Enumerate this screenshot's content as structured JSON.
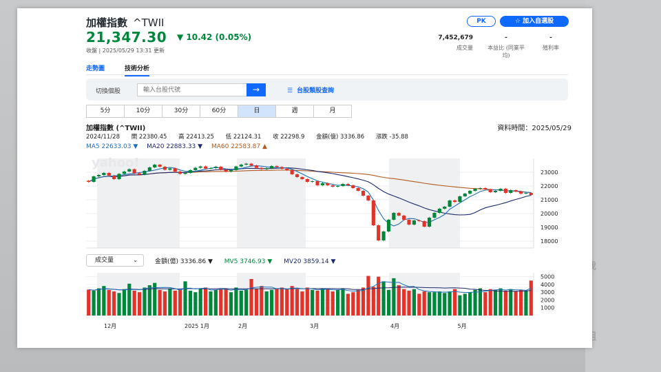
{
  "header": {
    "name": "加權指數",
    "symbol": "^TWII",
    "price": "21,347.30",
    "change": "▼ 10.42 (0.05%)",
    "closed_note": "收盤 | 2025/05/29 13:31 更新",
    "pk_label": "PK",
    "watch_label": "☆  加入自選股"
  },
  "stats": [
    {
      "value": "7,452,679",
      "label": "成交量"
    },
    {
      "value": "-",
      "label": "本益比 (同業平均)"
    },
    {
      "value": "-",
      "label": "殖利率"
    }
  ],
  "tabs": [
    {
      "label": "走勢圖",
      "active": false
    },
    {
      "label": "技術分析",
      "active": true
    }
  ],
  "switcher": {
    "label": "切換個股",
    "placeholder": "輸入台股代號",
    "go_icon": "→",
    "category_icon": "☰",
    "category_label": "台股類股查詢"
  },
  "intervals": [
    "5分",
    "10分",
    "30分",
    "60分",
    "日",
    "週",
    "月"
  ],
  "selected_interval": "日",
  "chart_header": {
    "title": "加權指數 (^TWII)",
    "data_time": "資料時間：2025/05/29",
    "date": "2024/11/28",
    "open": "開 22380.45",
    "high": "高 22413.25",
    "low": "低 22124.31",
    "close": "收 22298.9",
    "amount": "金額(億) 3336.86",
    "change": "漲跌 -35.88"
  },
  "ma": [
    {
      "label": "MA5 22633.03 ▼",
      "color": "#1f6fb5"
    },
    {
      "label": "MA20 22883.33 ▼",
      "color": "#1e2a6b"
    },
    {
      "label": "MA60 22583.87 ▲",
      "color": "#b35a1f"
    }
  ],
  "volume_header": {
    "select_label": "成交量",
    "amount": "金額(億) 3336.86 ▼",
    "mv5": "MV5 3746.93 ▼",
    "mv20": "MV20 3859.14 ▼"
  },
  "x_axis": [
    "12月",
    "2025 1月",
    "2月",
    "3月",
    "4月",
    "5月"
  ],
  "watermark": "yahoo!",
  "colors": {
    "up": "#00873c",
    "down": "#e0342b",
    "accent": "#0f69ff",
    "ma5": "#1f6fb5",
    "ma20": "#1e2a6b",
    "ma60": "#b35a1f"
  },
  "chart_data": [
    {
      "type": "candlestick",
      "title": "加權指數 (^TWII)",
      "ylim": [
        17000,
        24000
      ],
      "y_ticks": [
        18000,
        19000,
        20000,
        21000,
        22000,
        23000
      ],
      "x_labels": [
        "12月",
        "2025 1月",
        "2月",
        "3月",
        "4月",
        "5月"
      ],
      "close": [
        22298.9,
        22700,
        22800,
        22950,
        22750,
        22500,
        22880,
        23050,
        23220,
        22920,
        22830,
        23100,
        23350,
        23550,
        23400,
        23180,
        23280,
        23050,
        22880,
        22950,
        23150,
        23320,
        23420,
        23270,
        23300,
        23400,
        23180,
        23050,
        23150,
        23420,
        23550,
        23620,
        23480,
        23320,
        23220,
        23300,
        23450,
        23380,
        23250,
        23150,
        22850,
        22650,
        22500,
        22300,
        22350,
        22050,
        22200,
        22050,
        21950,
        22000,
        22150,
        22050,
        21850,
        21650,
        21300,
        20950,
        19150,
        18050,
        18700,
        19550,
        20050,
        19850,
        19550,
        19200,
        19500,
        19450,
        19050,
        19700,
        20050,
        20350,
        20500,
        20950,
        20850,
        21250,
        21450,
        21650,
        21800,
        21850,
        21750,
        21550,
        21650,
        21800,
        21500,
        21700,
        21600,
        21450,
        21500,
        21347.3
      ]
    },
    {
      "type": "bar",
      "title": "成交量",
      "ylim": [
        0,
        5500
      ],
      "y_ticks": [
        1000,
        2000,
        3000,
        4000,
        5000
      ],
      "values": [
        3336,
        3200,
        3500,
        3800,
        3300,
        3100,
        2900,
        3400,
        4100,
        3200,
        3000,
        3600,
        3900,
        4200,
        3300,
        3100,
        3500,
        3200,
        3300,
        4400,
        3200,
        3000,
        3500,
        3600,
        3100,
        3300,
        3400,
        3500,
        3000,
        3600,
        3200,
        3300,
        4700,
        3400,
        3800,
        3100,
        3300,
        3500,
        3600,
        3400,
        3800,
        3400,
        3100,
        3600,
        3300,
        3200,
        3500,
        3400,
        3100,
        3300,
        3500,
        2800,
        3000,
        3300,
        3600,
        5100,
        3700,
        5000,
        4400,
        3300,
        4800,
        3900,
        3400,
        3200,
        3400,
        2800,
        3100,
        3000,
        3000,
        3100,
        2900,
        3100,
        3400,
        2600,
        2800,
        3000,
        3300,
        3500,
        3000,
        3400,
        3300,
        3500,
        3200,
        3400,
        3100,
        3300,
        3200,
        4500
      ],
      "series": [
        {
          "name": "MV5",
          "value": 3746.93
        },
        {
          "name": "MV20",
          "value": 3859.14
        }
      ]
    }
  ]
}
